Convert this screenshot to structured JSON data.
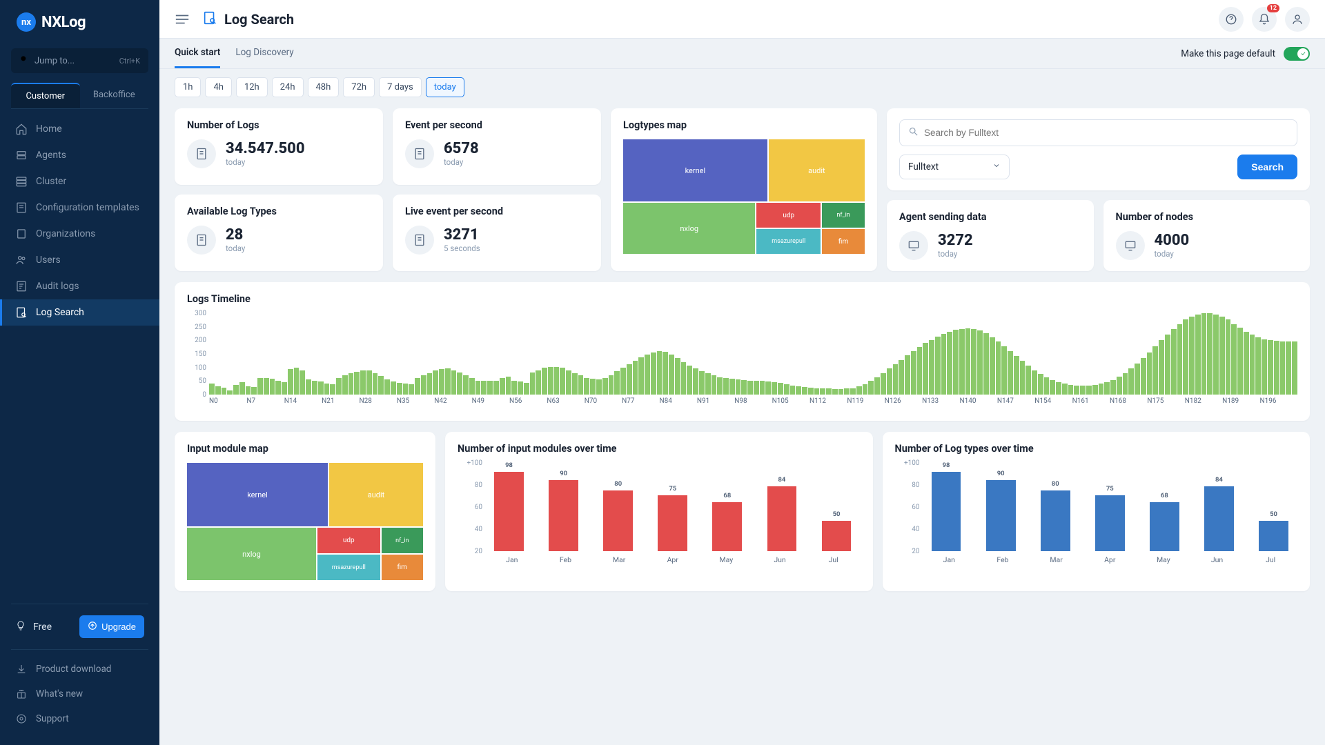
{
  "brand": {
    "badge": "nx",
    "name": "NXLog"
  },
  "jump": {
    "placeholder": "Jump to...",
    "shortcut": "Ctrl+K"
  },
  "sidebar_tabs": {
    "customer": "Customer",
    "backoffice": "Backoffice"
  },
  "nav": {
    "home": "Home",
    "agents": "Agents",
    "cluster": "Cluster",
    "config_templates": "Configuration templates",
    "organizations": "Organizations",
    "users": "Users",
    "audit_logs": "Audit logs",
    "log_search": "Log Search"
  },
  "plan": {
    "label": "Free",
    "upgrade": "Upgrade"
  },
  "bottom_links": {
    "download": "Product download",
    "whats_new": "What's new",
    "support": "Support"
  },
  "topbar": {
    "title": "Log Search",
    "notif_count": "12"
  },
  "subtabs": {
    "quick": "Quick start",
    "discovery": "Log Discovery"
  },
  "default_toggle_label": "Make this page default",
  "time_pills": [
    "1h",
    "4h",
    "12h",
    "24h",
    "48h",
    "72h",
    "7 days",
    "today"
  ],
  "stats": {
    "num_logs": {
      "title": "Number of Logs",
      "value": "34.547.500",
      "sub": "today"
    },
    "eps": {
      "title": "Event per second",
      "value": "6578",
      "sub": "today"
    },
    "avail_types": {
      "title": "Available Log Types",
      "value": "28",
      "sub": "today"
    },
    "live_eps": {
      "title": "Live event per second",
      "value": "3271",
      "sub": "5 seconds"
    },
    "agent_sending": {
      "title": "Agent sending data",
      "value": "3272",
      "sub": "today"
    },
    "nodes": {
      "title": "Number of nodes",
      "value": "4000",
      "sub": "today"
    }
  },
  "treemap": {
    "title": "Logtypes map",
    "kernel": "kernel",
    "audit": "audit",
    "nxlog": "nxlog",
    "udp": "udp",
    "nf_in": "nf_in",
    "msazurepull": "msazurepull",
    "fim": "fim"
  },
  "search": {
    "placeholder": "Search by Fulltext",
    "select_label": "Fulltext",
    "button": "Search"
  },
  "timeline": {
    "title": "Logs Timeline",
    "y_ticks": [
      "300",
      "250",
      "200",
      "150",
      "100",
      "50",
      "0"
    ],
    "x_ticks": [
      "N0",
      "N7",
      "N14",
      "N21",
      "N28",
      "N35",
      "N42",
      "N49",
      "N56",
      "N63",
      "N70",
      "N77",
      "N84",
      "N91",
      "N98",
      "N105",
      "N112",
      "N119",
      "N126",
      "N133",
      "N140",
      "N147",
      "N154",
      "N161",
      "N168",
      "N175",
      "N182",
      "N189",
      "N196"
    ]
  },
  "input_map": {
    "title": "Input module map"
  },
  "bar_input": {
    "title": "Number of input modules over time"
  },
  "bar_logtypes": {
    "title": "Number of Log types over time"
  },
  "chart_data": [
    {
      "id": "logtypes_treemap",
      "type": "treemap",
      "title": "Logtypes map",
      "items": [
        {
          "name": "kernel",
          "color": "#5563c1"
        },
        {
          "name": "audit",
          "color": "#f2c744"
        },
        {
          "name": "nxlog",
          "color": "#7cc46c"
        },
        {
          "name": "udp",
          "color": "#e34c4c"
        },
        {
          "name": "nf_in",
          "color": "#3a9a5a"
        },
        {
          "name": "msazurepull",
          "color": "#4bb9c4"
        },
        {
          "name": "fim",
          "color": "#e88a3a"
        }
      ]
    },
    {
      "id": "logs_timeline",
      "type": "bar",
      "title": "Logs Timeline",
      "ylim": [
        0,
        300
      ],
      "x_labels": [
        "N0",
        "N7",
        "N14",
        "N21",
        "N28",
        "N35",
        "N42",
        "N49",
        "N56",
        "N63",
        "N70",
        "N77",
        "N84",
        "N91",
        "N98",
        "N105",
        "N112",
        "N119",
        "N126",
        "N133",
        "N140",
        "N147",
        "N154",
        "N161",
        "N168",
        "N175",
        "N182",
        "N189",
        "N196"
      ],
      "values": [
        40,
        30,
        25,
        15,
        35,
        45,
        30,
        28,
        60,
        62,
        58,
        50,
        45,
        95,
        100,
        90,
        55,
        50,
        48,
        40,
        38,
        60,
        70,
        78,
        84,
        88,
        90,
        80,
        68,
        56,
        48,
        42,
        40,
        38,
        62,
        72,
        80,
        88,
        94,
        96,
        90,
        82,
        72,
        60,
        50,
        50,
        50,
        50,
        60,
        65,
        52,
        48,
        44,
        82,
        90,
        100,
        102,
        102,
        100,
        90,
        80,
        70,
        62,
        58,
        56,
        60,
        72,
        86,
        98,
        112,
        124,
        138,
        148,
        156,
        160,
        158,
        148,
        134,
        120,
        108,
        96,
        86,
        78,
        70,
        64,
        60,
        58,
        56,
        54,
        52,
        52,
        50,
        48,
        46,
        42,
        38,
        34,
        30,
        28,
        26,
        24,
        22,
        22,
        20,
        20,
        22,
        24,
        30,
        38,
        50,
        64,
        80,
        96,
        112,
        128,
        144,
        160,
        176,
        190,
        202,
        214,
        224,
        232,
        238,
        242,
        244,
        242,
        236,
        226,
        212,
        196,
        178,
        160,
        142,
        124,
        106,
        90,
        76,
        64,
        54,
        46,
        40,
        36,
        34,
        34,
        34,
        36,
        40,
        46,
        54,
        66,
        80,
        96,
        114,
        134,
        156,
        178,
        200,
        222,
        242,
        260,
        276,
        288,
        296,
        300,
        300,
        296,
        288,
        276,
        260,
        246,
        232,
        220,
        210,
        204,
        200,
        198,
        196,
        196,
        196
      ]
    },
    {
      "id": "input_module_treemap",
      "type": "treemap",
      "title": "Input module map",
      "items": [
        {
          "name": "kernel",
          "color": "#5563c1"
        },
        {
          "name": "audit",
          "color": "#f2c744"
        },
        {
          "name": "nxlog",
          "color": "#7cc46c"
        },
        {
          "name": "udp",
          "color": "#e34c4c"
        },
        {
          "name": "nf_in",
          "color": "#3a9a5a"
        },
        {
          "name": "msazurepull",
          "color": "#4bb9c4"
        },
        {
          "name": "fim",
          "color": "#e88a3a"
        }
      ]
    },
    {
      "id": "input_modules_over_time",
      "type": "bar",
      "title": "Number of input modules over time",
      "ylabel_prefix": "+100",
      "ylim": [
        20,
        100
      ],
      "categories": [
        "Jan",
        "Feb",
        "Mar",
        "Apr",
        "May",
        "Jun",
        "Jul"
      ],
      "values": [
        98,
        90,
        80,
        75,
        68,
        84,
        50
      ],
      "color": "#e34c4c"
    },
    {
      "id": "log_types_over_time",
      "type": "bar",
      "title": "Number of Log types over time",
      "ylabel_prefix": "+100",
      "ylim": [
        20,
        100
      ],
      "categories": [
        "Jan",
        "Feb",
        "Mar",
        "Apr",
        "May",
        "Jun",
        "Jul"
      ],
      "values": [
        98,
        90,
        80,
        75,
        68,
        84,
        50
      ],
      "color": "#3a78c2"
    }
  ]
}
